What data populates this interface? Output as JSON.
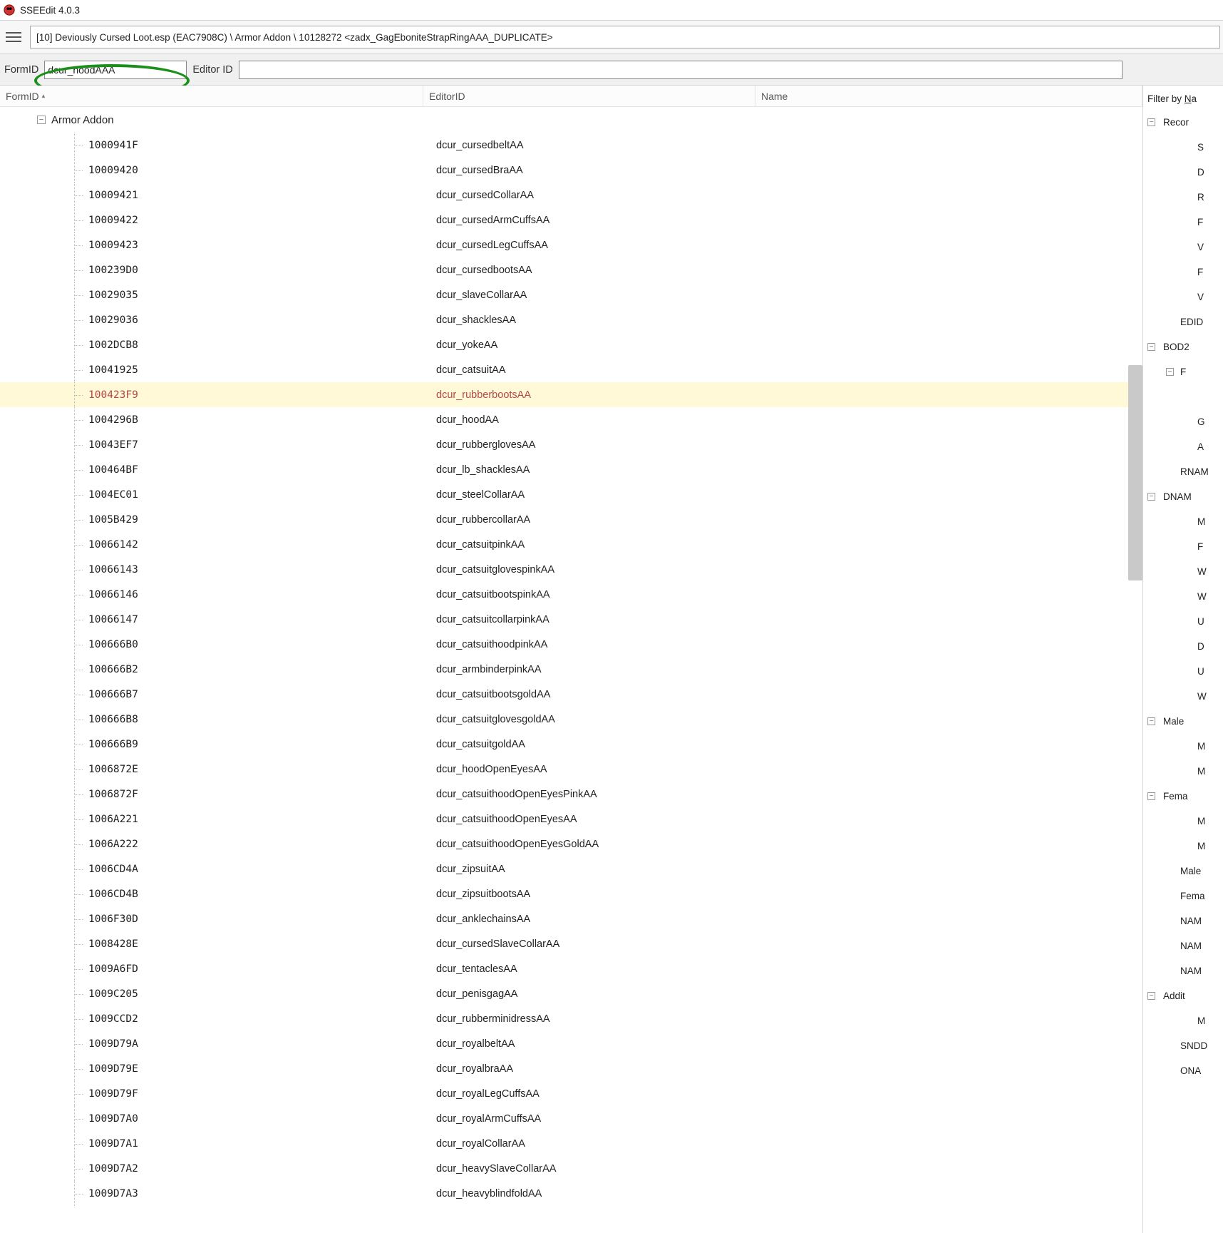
{
  "app": {
    "title": "SSEEdit 4.0.3",
    "path": "[10] Deviously Cursed Loot.esp (EAC7908C) \\ Armor Addon \\ 10128272 <zadx_GagEboniteStrapRingAAA_DUPLICATE>"
  },
  "search": {
    "formid_label": "FormID",
    "formid_value": "dcur_hoodAAA",
    "editorid_label": "Editor ID",
    "editorid_value": ""
  },
  "grid": {
    "col1": "FormID",
    "col2": "EditorID",
    "col3": "Name",
    "group": "Armor Addon"
  },
  "rows": [
    {
      "id": "1000941F",
      "ed": "dcur_cursedbeltAA"
    },
    {
      "id": "10009420",
      "ed": "dcur_cursedBraAA"
    },
    {
      "id": "10009421",
      "ed": "dcur_cursedCollarAA"
    },
    {
      "id": "10009422",
      "ed": "dcur_cursedArmCuffsAA"
    },
    {
      "id": "10009423",
      "ed": "dcur_cursedLegCuffsAA"
    },
    {
      "id": "100239D0",
      "ed": "dcur_cursedbootsAA"
    },
    {
      "id": "10029035",
      "ed": "dcur_slaveCollarAA"
    },
    {
      "id": "10029036",
      "ed": "dcur_shacklesAA"
    },
    {
      "id": "1002DCB8",
      "ed": "dcur_yokeAA"
    },
    {
      "id": "10041925",
      "ed": "dcur_catsuitAA"
    },
    {
      "id": "100423F9",
      "ed": "dcur_rubberbootsAA",
      "hl": true
    },
    {
      "id": "1004296B",
      "ed": "dcur_hoodAA"
    },
    {
      "id": "10043EF7",
      "ed": "dcur_rubberglovesAA"
    },
    {
      "id": "100464BF",
      "ed": "dcur_lb_shacklesAA"
    },
    {
      "id": "1004EC01",
      "ed": "dcur_steelCollarAA"
    },
    {
      "id": "1005B429",
      "ed": "dcur_rubbercollarAA"
    },
    {
      "id": "10066142",
      "ed": "dcur_catsuitpinkAA"
    },
    {
      "id": "10066143",
      "ed": "dcur_catsuitglovespinkAA"
    },
    {
      "id": "10066146",
      "ed": "dcur_catsuitbootspinkAA"
    },
    {
      "id": "10066147",
      "ed": "dcur_catsuitcollarpinkAA"
    },
    {
      "id": "100666B0",
      "ed": "dcur_catsuithoodpinkAA"
    },
    {
      "id": "100666B2",
      "ed": "dcur_armbinderpinkAA"
    },
    {
      "id": "100666B7",
      "ed": "dcur_catsuitbootsgoldAA"
    },
    {
      "id": "100666B8",
      "ed": "dcur_catsuitglovesgoldAA"
    },
    {
      "id": "100666B9",
      "ed": "dcur_catsuitgoldAA"
    },
    {
      "id": "1006872E",
      "ed": "dcur_hoodOpenEyesAA"
    },
    {
      "id": "1006872F",
      "ed": "dcur_catsuithoodOpenEyesPinkAA"
    },
    {
      "id": "1006A221",
      "ed": "dcur_catsuithoodOpenEyesAA"
    },
    {
      "id": "1006A222",
      "ed": "dcur_catsuithoodOpenEyesGoldAA"
    },
    {
      "id": "1006CD4A",
      "ed": "dcur_zipsuitAA"
    },
    {
      "id": "1006CD4B",
      "ed": "dcur_zipsuitbootsAA"
    },
    {
      "id": "1006F30D",
      "ed": "dcur_anklechainsAA"
    },
    {
      "id": "1008428E",
      "ed": "dcur_cursedSlaveCollarAA"
    },
    {
      "id": "1009A6FD",
      "ed": "dcur_tentaclesAA"
    },
    {
      "id": "1009C205",
      "ed": "dcur_penisgagAA"
    },
    {
      "id": "1009CCD2",
      "ed": "dcur_rubberminidressAA"
    },
    {
      "id": "1009D79A",
      "ed": "dcur_royalbeltAA"
    },
    {
      "id": "1009D79E",
      "ed": "dcur_royalbraAA"
    },
    {
      "id": "1009D79F",
      "ed": "dcur_royalLegCuffsAA"
    },
    {
      "id": "1009D7A0",
      "ed": "dcur_royalArmCuffsAA"
    },
    {
      "id": "1009D7A1",
      "ed": "dcur_royalCollarAA"
    },
    {
      "id": "1009D7A2",
      "ed": "dcur_heavySlaveCollarAA"
    },
    {
      "id": "1009D7A3",
      "ed": "dcur_heavyblindfoldAA"
    }
  ],
  "right": {
    "filter": "Filter by Na",
    "nodes": [
      {
        "t": "Recor",
        "tog": "-",
        "d": 0
      },
      {
        "t": "S",
        "d": 2
      },
      {
        "t": "D",
        "d": 2
      },
      {
        "t": "R",
        "d": 2
      },
      {
        "t": "F",
        "d": 2
      },
      {
        "t": "V",
        "d": 2
      },
      {
        "t": "F",
        "d": 2
      },
      {
        "t": "V",
        "d": 2
      },
      {
        "t": "EDID",
        "d": 1
      },
      {
        "t": "BOD2",
        "tog": "-",
        "d": 0
      },
      {
        "t": "F",
        "tog": "-",
        "d": 1
      },
      {
        "t": "",
        "d": 2
      },
      {
        "t": "G",
        "d": 2
      },
      {
        "t": "A",
        "d": 2
      },
      {
        "t": "RNAM",
        "d": 1
      },
      {
        "t": "DNAM",
        "tog": "-",
        "d": 0
      },
      {
        "t": "M",
        "d": 2
      },
      {
        "t": "F",
        "d": 2
      },
      {
        "t": "W",
        "d": 2
      },
      {
        "t": "W",
        "d": 2
      },
      {
        "t": "U",
        "d": 2
      },
      {
        "t": "D",
        "d": 2
      },
      {
        "t": "U",
        "d": 2
      },
      {
        "t": "W",
        "d": 2
      },
      {
        "t": "Male",
        "tog": "-",
        "d": 0
      },
      {
        "t": "M",
        "d": 2
      },
      {
        "t": "M",
        "d": 2
      },
      {
        "t": "Fema",
        "tog": "-",
        "d": 0
      },
      {
        "t": "M",
        "d": 2
      },
      {
        "t": "M",
        "d": 2
      },
      {
        "t": "Male",
        "d": 1,
        "gray": true
      },
      {
        "t": "Fema",
        "d": 1,
        "gray": true
      },
      {
        "t": "NAM",
        "d": 1,
        "gray": true
      },
      {
        "t": "NAM",
        "d": 1,
        "gray": true
      },
      {
        "t": "NAM",
        "d": 1,
        "gray": true
      },
      {
        "t": "Addit",
        "tog": "-",
        "d": 0
      },
      {
        "t": "M",
        "d": 2
      },
      {
        "t": "SNDD",
        "d": 1,
        "gray": true
      },
      {
        "t": "ONA",
        "d": 1,
        "gray": true
      }
    ]
  }
}
